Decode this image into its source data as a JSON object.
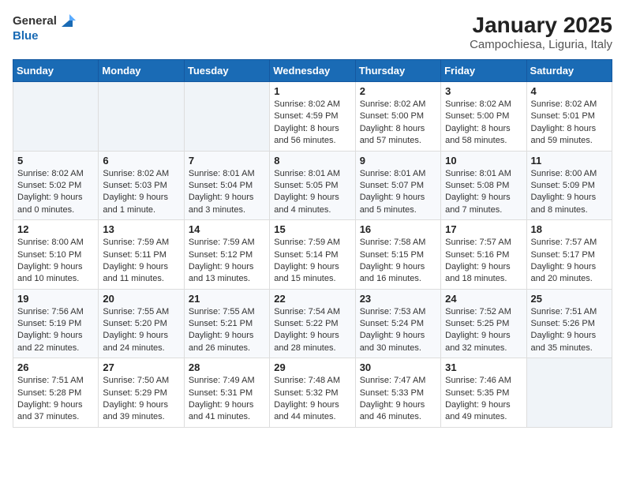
{
  "header": {
    "logo_text_general": "General",
    "logo_text_blue": "Blue",
    "month_title": "January 2025",
    "subtitle": "Campochiesa, Liguria, Italy"
  },
  "weekdays": [
    "Sunday",
    "Monday",
    "Tuesday",
    "Wednesday",
    "Thursday",
    "Friday",
    "Saturday"
  ],
  "weeks": [
    [
      {
        "day": "",
        "info": ""
      },
      {
        "day": "",
        "info": ""
      },
      {
        "day": "",
        "info": ""
      },
      {
        "day": "1",
        "info": "Sunrise: 8:02 AM\nSunset: 4:59 PM\nDaylight: 8 hours and 56 minutes."
      },
      {
        "day": "2",
        "info": "Sunrise: 8:02 AM\nSunset: 5:00 PM\nDaylight: 8 hours and 57 minutes."
      },
      {
        "day": "3",
        "info": "Sunrise: 8:02 AM\nSunset: 5:00 PM\nDaylight: 8 hours and 58 minutes."
      },
      {
        "day": "4",
        "info": "Sunrise: 8:02 AM\nSunset: 5:01 PM\nDaylight: 8 hours and 59 minutes."
      }
    ],
    [
      {
        "day": "5",
        "info": "Sunrise: 8:02 AM\nSunset: 5:02 PM\nDaylight: 9 hours and 0 minutes."
      },
      {
        "day": "6",
        "info": "Sunrise: 8:02 AM\nSunset: 5:03 PM\nDaylight: 9 hours and 1 minute."
      },
      {
        "day": "7",
        "info": "Sunrise: 8:01 AM\nSunset: 5:04 PM\nDaylight: 9 hours and 3 minutes."
      },
      {
        "day": "8",
        "info": "Sunrise: 8:01 AM\nSunset: 5:05 PM\nDaylight: 9 hours and 4 minutes."
      },
      {
        "day": "9",
        "info": "Sunrise: 8:01 AM\nSunset: 5:07 PM\nDaylight: 9 hours and 5 minutes."
      },
      {
        "day": "10",
        "info": "Sunrise: 8:01 AM\nSunset: 5:08 PM\nDaylight: 9 hours and 7 minutes."
      },
      {
        "day": "11",
        "info": "Sunrise: 8:00 AM\nSunset: 5:09 PM\nDaylight: 9 hours and 8 minutes."
      }
    ],
    [
      {
        "day": "12",
        "info": "Sunrise: 8:00 AM\nSunset: 5:10 PM\nDaylight: 9 hours and 10 minutes."
      },
      {
        "day": "13",
        "info": "Sunrise: 7:59 AM\nSunset: 5:11 PM\nDaylight: 9 hours and 11 minutes."
      },
      {
        "day": "14",
        "info": "Sunrise: 7:59 AM\nSunset: 5:12 PM\nDaylight: 9 hours and 13 minutes."
      },
      {
        "day": "15",
        "info": "Sunrise: 7:59 AM\nSunset: 5:14 PM\nDaylight: 9 hours and 15 minutes."
      },
      {
        "day": "16",
        "info": "Sunrise: 7:58 AM\nSunset: 5:15 PM\nDaylight: 9 hours and 16 minutes."
      },
      {
        "day": "17",
        "info": "Sunrise: 7:57 AM\nSunset: 5:16 PM\nDaylight: 9 hours and 18 minutes."
      },
      {
        "day": "18",
        "info": "Sunrise: 7:57 AM\nSunset: 5:17 PM\nDaylight: 9 hours and 20 minutes."
      }
    ],
    [
      {
        "day": "19",
        "info": "Sunrise: 7:56 AM\nSunset: 5:19 PM\nDaylight: 9 hours and 22 minutes."
      },
      {
        "day": "20",
        "info": "Sunrise: 7:55 AM\nSunset: 5:20 PM\nDaylight: 9 hours and 24 minutes."
      },
      {
        "day": "21",
        "info": "Sunrise: 7:55 AM\nSunset: 5:21 PM\nDaylight: 9 hours and 26 minutes."
      },
      {
        "day": "22",
        "info": "Sunrise: 7:54 AM\nSunset: 5:22 PM\nDaylight: 9 hours and 28 minutes."
      },
      {
        "day": "23",
        "info": "Sunrise: 7:53 AM\nSunset: 5:24 PM\nDaylight: 9 hours and 30 minutes."
      },
      {
        "day": "24",
        "info": "Sunrise: 7:52 AM\nSunset: 5:25 PM\nDaylight: 9 hours and 32 minutes."
      },
      {
        "day": "25",
        "info": "Sunrise: 7:51 AM\nSunset: 5:26 PM\nDaylight: 9 hours and 35 minutes."
      }
    ],
    [
      {
        "day": "26",
        "info": "Sunrise: 7:51 AM\nSunset: 5:28 PM\nDaylight: 9 hours and 37 minutes."
      },
      {
        "day": "27",
        "info": "Sunrise: 7:50 AM\nSunset: 5:29 PM\nDaylight: 9 hours and 39 minutes."
      },
      {
        "day": "28",
        "info": "Sunrise: 7:49 AM\nSunset: 5:31 PM\nDaylight: 9 hours and 41 minutes."
      },
      {
        "day": "29",
        "info": "Sunrise: 7:48 AM\nSunset: 5:32 PM\nDaylight: 9 hours and 44 minutes."
      },
      {
        "day": "30",
        "info": "Sunrise: 7:47 AM\nSunset: 5:33 PM\nDaylight: 9 hours and 46 minutes."
      },
      {
        "day": "31",
        "info": "Sunrise: 7:46 AM\nSunset: 5:35 PM\nDaylight: 9 hours and 49 minutes."
      },
      {
        "day": "",
        "info": ""
      }
    ]
  ]
}
